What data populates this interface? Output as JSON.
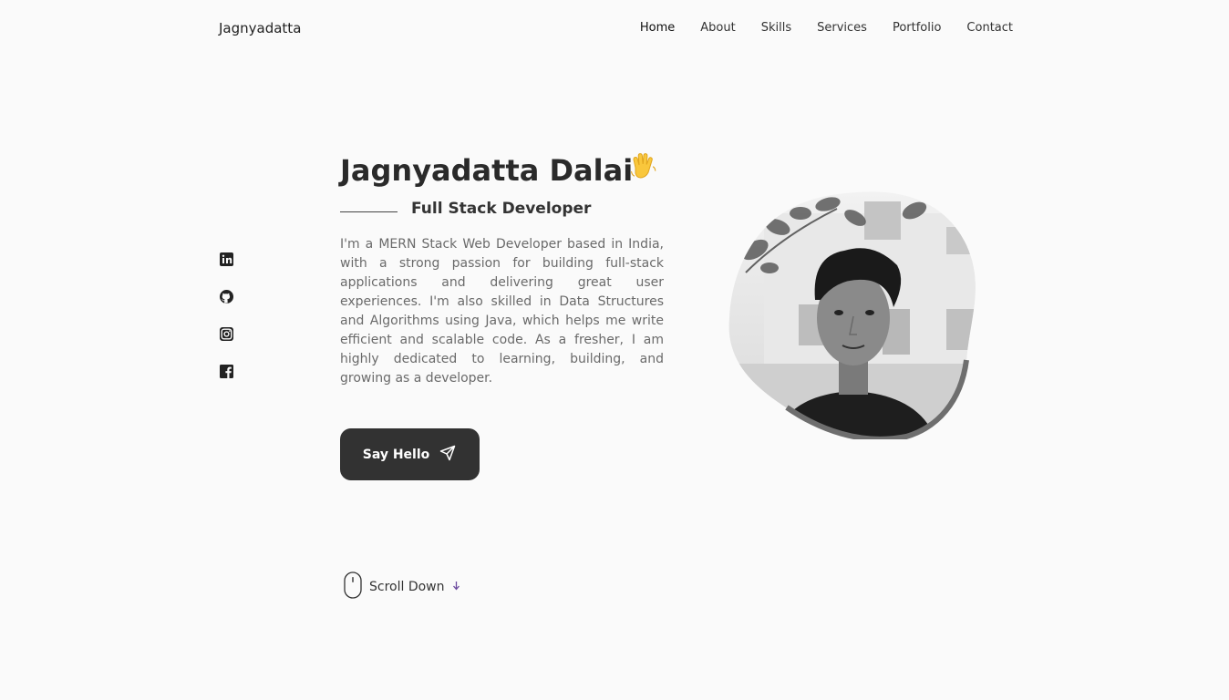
{
  "brand": "Jagnyadatta",
  "nav": {
    "items": [
      "Home",
      "About",
      "Skills",
      "Services",
      "Portfolio",
      "Contact"
    ]
  },
  "hero": {
    "name": "Jagnyadatta Dalai",
    "subtitle": "Full Stack Developer",
    "description": "I'm a MERN Stack Web Developer based in India, with a strong passion for building full-stack applications and delivering great user experiences. I'm also skilled in Data Structures and Algorithms using Java, which helps me write efficient and scalable code. As a fresher, I am highly dedicated to learning, building, and growing as a developer.",
    "cta_label": "Say Hello",
    "scroll_label": "Scroll Down"
  },
  "socials": [
    "linkedin-icon",
    "github-icon",
    "instagram-icon",
    "facebook-icon"
  ],
  "colors": {
    "background": "#fafafa",
    "button": "#323232",
    "text": "#2b2b2b",
    "muted_text": "#6a6a6a",
    "accent_arrow": "#6c4a9e"
  }
}
